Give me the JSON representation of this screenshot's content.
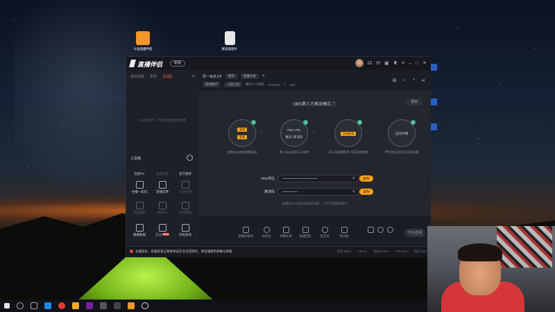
{
  "desktop": {
    "icons": [
      {
        "label": "斗鱼直播伴侣",
        "color": "#f3962a"
      },
      {
        "label": "解说类图片",
        "color": "#e8e8e8"
      }
    ]
  },
  "window": {
    "logo_text": "直播伴侣",
    "version_label": "新版",
    "titlebar_icons": [
      "avatar",
      "headset-icon",
      "mail-icon",
      "screen-icon",
      "shirt-icon",
      "menu-icon",
      "minimize-icon",
      "maximize-icon",
      "close-icon"
    ]
  },
  "left_panel": {
    "tabs": [
      "我的场景",
      "素材",
      "互动区"
    ],
    "active_tab": 2,
    "empty_text": "OBS模式下，不能添加素材和场景",
    "tools_title": "工具箱",
    "tools": [
      [
        {
          "label": "连麦PK",
          "state": "normal"
        },
        {
          "label": "连麦语音",
          "state": "dim"
        },
        {
          "label": "官方推荐",
          "state": "normal"
        }
      ],
      [
        {
          "label": "主播一起玩",
          "state": "normal"
        },
        {
          "label": "直播竞猜",
          "state": "normal"
        },
        {
          "label": "互动礼物",
          "state": "dim"
        }
      ],
      [
        {
          "label": "粉丝福利",
          "state": "dim"
        },
        {
          "label": "粉丝PK",
          "state": "dim"
        },
        {
          "label": "礼物直播",
          "state": "dim"
        }
      ],
      [
        {
          "label": "健康数据",
          "state": "normal"
        },
        {
          "label": "互动",
          "state": "blue",
          "badge": "NEW"
        },
        {
          "label": "日程安排",
          "state": "normal"
        }
      ]
    ]
  },
  "main": {
    "info_line1": {
      "title": "周一休息1天",
      "chip1": "修改",
      "chip2": "直播分类"
    },
    "info_line2": {
      "chip": "游戏教学",
      "category": "三国之战",
      "rank": "每日人气排名",
      "viewers": "1476713",
      "hot": "152"
    },
    "stage": {
      "title": "OBS第三方推流模式",
      "exit_label": "退出",
      "steps": [
        {
          "num": "1",
          "btn1": "复制",
          "btn2": "复制",
          "cap": "复制rtmp地址和推流码"
        },
        {
          "num": "2",
          "line1": "OBS URL",
          "line2": "推流 /串流码",
          "cap": "填入OBS等第三方软件"
        },
        {
          "num": "3",
          "btn": "开始推流",
          "cap": "第三方直播软件 点击开始推流"
        },
        {
          "num": "4",
          "line1": "自动开播",
          "cap": "伴侣将自动识别 自动开播"
        }
      ],
      "arrow": "»",
      "rtmp_label": "rtmp地址",
      "rtmp_value": "••••••••••••••••••••••••••••••••",
      "key_label": "推流码",
      "key_value": "••••••••••••••",
      "copy_label": "复制",
      "hint": "关播后rtmp地址会重新刷新，下次无需重复填写"
    },
    "bottom_tools": [
      "直播间管理",
      "视频连",
      "弹幕礼物",
      "直播回放",
      "麦克风",
      "扬声器"
    ],
    "start_label": "开始直播"
  },
  "status": {
    "notice": "主播您好，给嘉宾发言需要保证在合法范围内，请合理使用弹幕与弹窗",
    "stats": [
      "码率:0kb/s",
      "FPS:0",
      "丢帧:0.00%",
      "CPU:0%",
      "内存:12%"
    ]
  }
}
